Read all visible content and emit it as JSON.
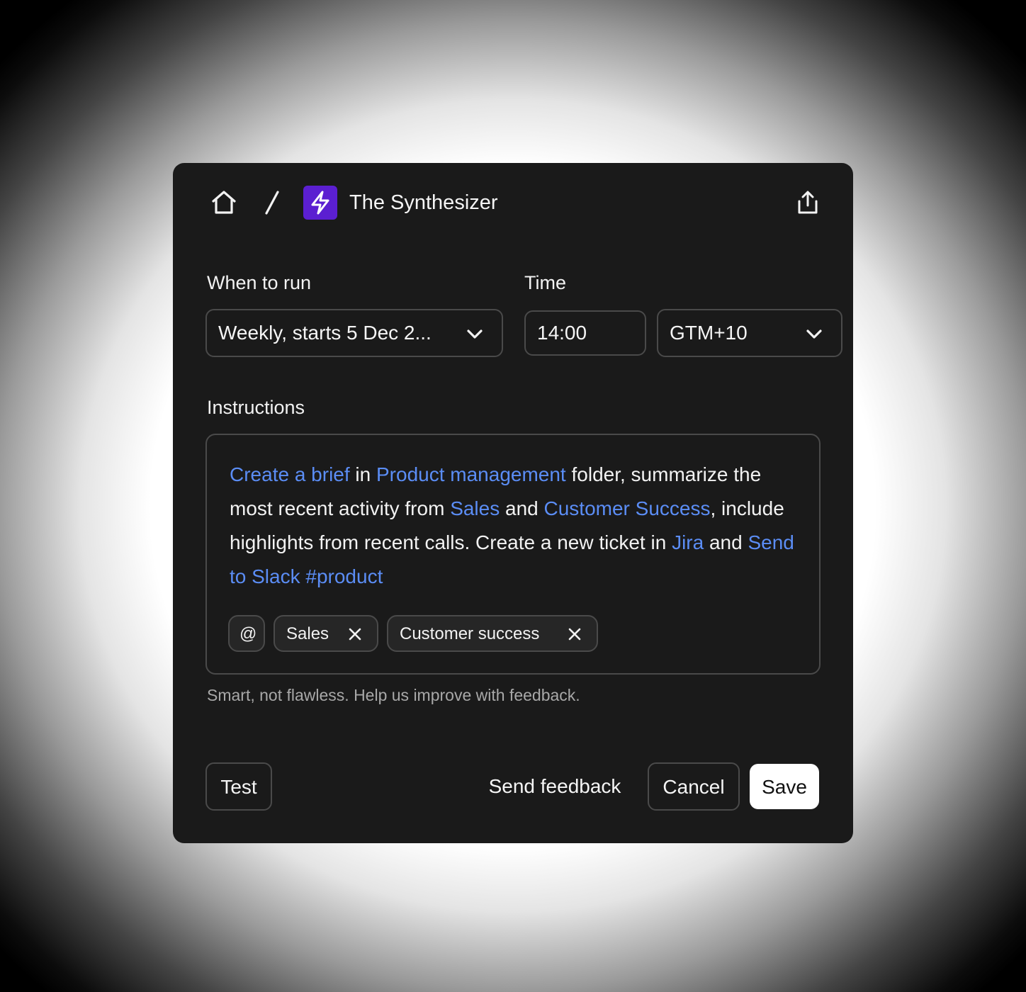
{
  "header": {
    "home_icon": "home-icon",
    "separator": "/",
    "app_icon": "lightning-icon",
    "app_icon_bg": "#5b1fd1",
    "title": "The Synthesizer",
    "share_icon": "share-icon"
  },
  "schedule": {
    "when_label": "When to run",
    "when_value": "Weekly, starts 5 Dec 2...",
    "time_label": "Time",
    "time_value": "14:00",
    "timezone_value": "GTM+10"
  },
  "instructions": {
    "label": "Instructions",
    "segments": [
      {
        "text": "Create a brief",
        "highlight": true
      },
      {
        "text": " in ",
        "highlight": false
      },
      {
        "text": "Product management",
        "highlight": true
      },
      {
        "text": " folder, summarize the most recent activity from ",
        "highlight": false
      },
      {
        "text": "Sales",
        "highlight": true
      },
      {
        "text": " and ",
        "highlight": false
      },
      {
        "text": "Customer Success",
        "highlight": true
      },
      {
        "text": ", include highlights from recent calls. Create a new ticket in ",
        "highlight": false
      },
      {
        "text": "Jira",
        "highlight": true
      },
      {
        "text": " and ",
        "highlight": false
      },
      {
        "text": "Send to Slack #product",
        "highlight": true
      }
    ],
    "mention_button": "@",
    "tags": [
      "Sales",
      "Customer success"
    ],
    "highlight_color": "#5b8df5"
  },
  "footnote": "Smart, not flawless. Help us improve with feedback.",
  "footer": {
    "test_label": "Test",
    "feedback_label": "Send feedback",
    "cancel_label": "Cancel",
    "save_label": "Save"
  }
}
